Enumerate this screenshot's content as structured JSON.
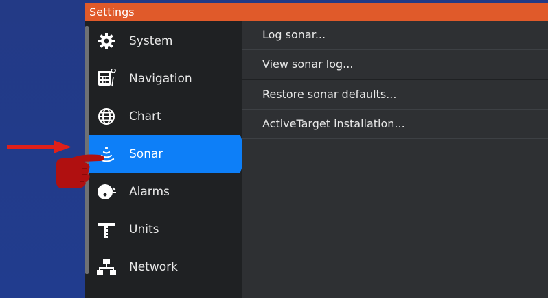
{
  "window": {
    "title": "Settings"
  },
  "sidebar": {
    "items": [
      {
        "label": "System",
        "icon": "gear-icon",
        "selected": false
      },
      {
        "label": "Navigation",
        "icon": "calculator-icon",
        "selected": false
      },
      {
        "label": "Chart",
        "icon": "globe-icon",
        "selected": false
      },
      {
        "label": "Sonar",
        "icon": "sonar-icon",
        "selected": true
      },
      {
        "label": "Alarms",
        "icon": "alarm-bell-icon",
        "selected": false
      },
      {
        "label": "Units",
        "icon": "ruler-icon",
        "selected": false
      },
      {
        "label": "Network",
        "icon": "network-icon",
        "selected": false
      }
    ]
  },
  "content": {
    "items": [
      {
        "label": "Log sonar..."
      },
      {
        "label": "View sonar log..."
      },
      {
        "label": "Restore sonar defaults..."
      },
      {
        "label": "ActiveTarget installation..."
      }
    ]
  },
  "annotations": {
    "arrow_color": "#e0201a",
    "hand_color": "#b01010"
  },
  "colors": {
    "titlebar": "#e05a2a",
    "selected": "#0d7ff8",
    "background": "#223b8a"
  }
}
